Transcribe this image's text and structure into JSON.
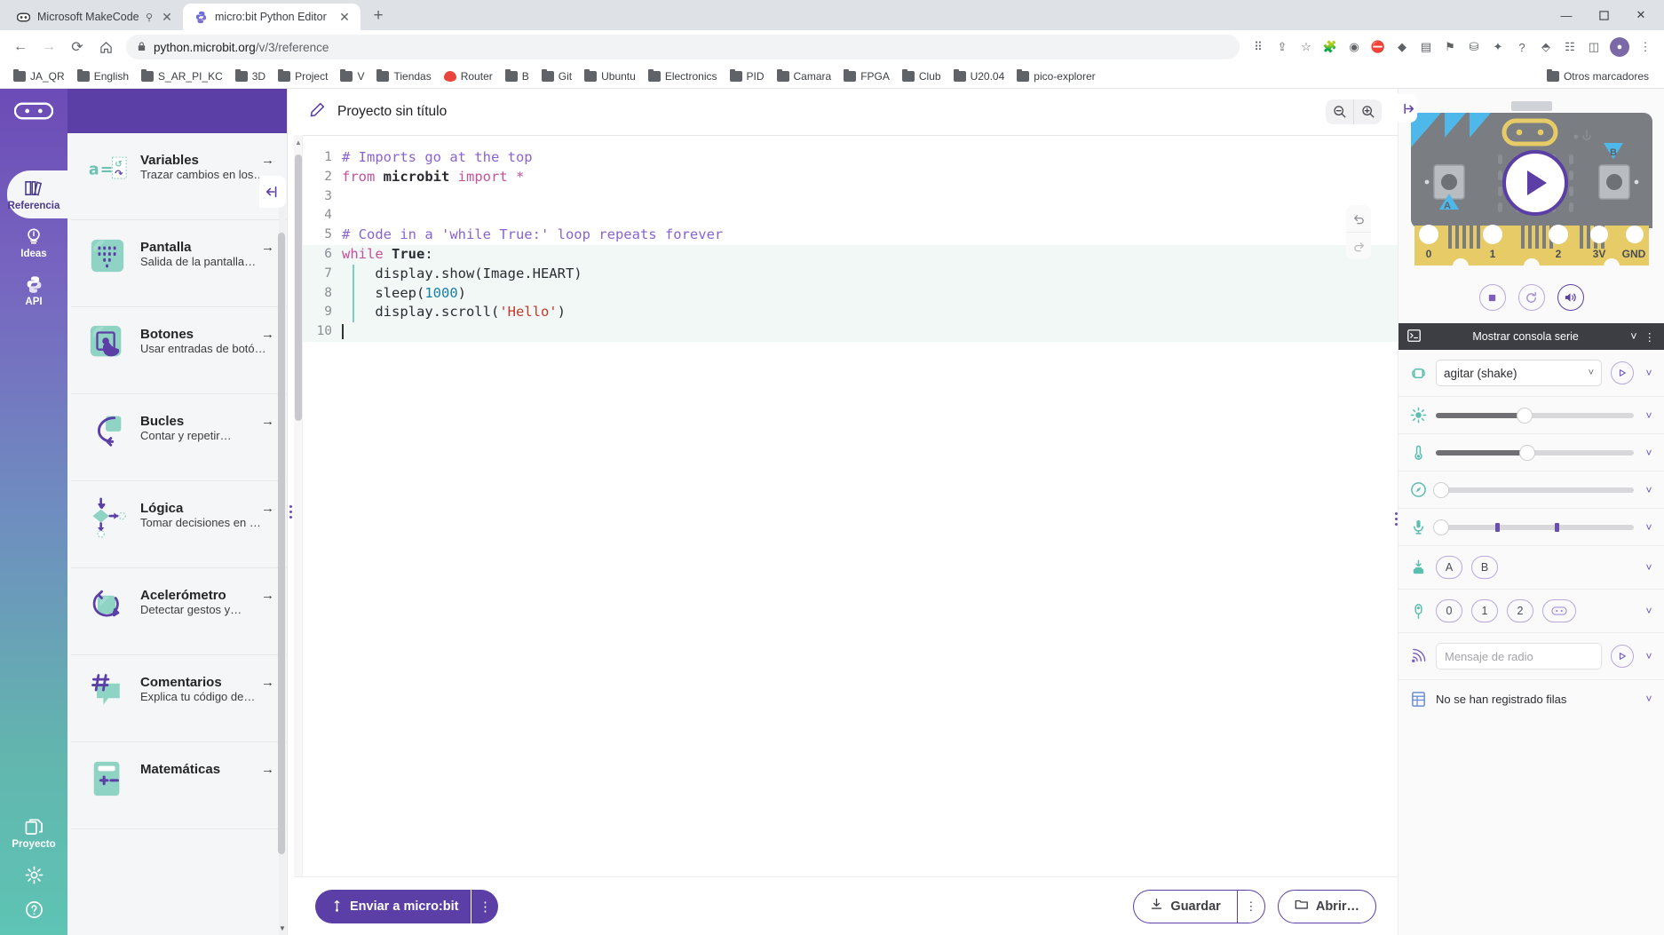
{
  "browser": {
    "tabs": [
      {
        "title": "Microsoft MakeCode for m",
        "favicon": "makecode-icon",
        "active": false
      },
      {
        "title": "micro:bit Python Editor",
        "favicon": "python-icon",
        "active": true
      }
    ],
    "new_tab_label": "+",
    "window_controls": {
      "minimize": "—",
      "maximize": "❑",
      "close": "✕"
    },
    "nav": {
      "back": "←",
      "forward": "→",
      "reload": "⟳",
      "home": "⌂"
    },
    "omnibox": {
      "lock": "🔒",
      "url_main": "python.microbit.org",
      "url_rest": "/v/3/reference"
    },
    "toolbar_icons": [
      "translate-icon",
      "share-icon",
      "star-icon",
      "extension-puzzle-icon",
      "grammarly-icon",
      "adblock-icon",
      "colorpick-icon",
      "wallet-icon",
      "bookmark-manager-icon",
      "screencast-icon",
      "lastpass-icon",
      "help-icon",
      "extensions-icon",
      "reading-list-icon",
      "sidepanel-icon"
    ],
    "profile_initial": "👤",
    "menu_icon": "⋮",
    "bookmarks": [
      {
        "label": "JA_QR",
        "icon": "folder-icon"
      },
      {
        "label": "English",
        "icon": "folder-icon"
      },
      {
        "label": "S_AR_PI_KC",
        "icon": "folder-icon"
      },
      {
        "label": "3D",
        "icon": "folder-icon"
      },
      {
        "label": "Project",
        "icon": "folder-icon"
      },
      {
        "label": "V",
        "icon": "folder-icon"
      },
      {
        "label": "Tiendas",
        "icon": "folder-icon"
      },
      {
        "label": "Router",
        "icon": "vodafone-icon"
      },
      {
        "label": "B",
        "icon": "folder-icon"
      },
      {
        "label": "Git",
        "icon": "folder-icon"
      },
      {
        "label": "Ubuntu",
        "icon": "folder-icon"
      },
      {
        "label": "Electronics",
        "icon": "folder-icon"
      },
      {
        "label": "PID",
        "icon": "folder-icon"
      },
      {
        "label": "Camara",
        "icon": "folder-icon"
      },
      {
        "label": "FPGA",
        "icon": "folder-icon"
      },
      {
        "label": "Club",
        "icon": "folder-icon"
      },
      {
        "label": "U20.04",
        "icon": "folder-icon"
      },
      {
        "label": "pico-explorer",
        "icon": "folder-icon"
      }
    ],
    "bookmarks_right": {
      "label": "Otros marcadores",
      "icon": "folder-icon"
    }
  },
  "rail": {
    "logo": "micro:bit",
    "search_icon": "search-icon",
    "items": [
      {
        "label": "Referencia",
        "icon": "book-icon",
        "active": true
      },
      {
        "label": "Ideas",
        "icon": "lightbulb-icon",
        "active": false
      },
      {
        "label": "API",
        "icon": "python-icon",
        "active": false
      }
    ],
    "bottom_items": [
      {
        "label": "Proyecto",
        "icon": "files-icon"
      },
      {
        "label": "",
        "icon": "gear-icon"
      },
      {
        "label": "",
        "icon": "help-circle-icon"
      }
    ]
  },
  "reference": {
    "collapse_icon": "collapse-left-icon",
    "items": [
      {
        "title": "Variables",
        "desc": "Trazar cambios en los…",
        "icon": "variables-icon",
        "arrow": "→"
      },
      {
        "title": "Pantalla",
        "desc": "Salida de la pantalla…",
        "icon": "display-icon",
        "arrow": "→"
      },
      {
        "title": "Botones",
        "desc": "Usar entradas de botó…",
        "icon": "buttons-icon",
        "arrow": "→"
      },
      {
        "title": "Bucles",
        "desc": "Contar y repetir…",
        "icon": "loops-icon",
        "arrow": "→"
      },
      {
        "title": "Lógica",
        "desc": "Tomar decisiones en …",
        "icon": "logic-icon",
        "arrow": "→"
      },
      {
        "title": "Acelerómetro",
        "desc": "Detectar gestos y…",
        "icon": "accelerometer-icon",
        "arrow": "→"
      },
      {
        "title": "Comentarios",
        "desc": "Explica tu código de…",
        "icon": "comments-icon",
        "arrow": "→"
      },
      {
        "title": "Matemáticas",
        "desc": "",
        "icon": "math-icon",
        "arrow": "→"
      }
    ]
  },
  "editor": {
    "pencil_icon": "pencil-icon",
    "project_title": "Proyecto sin título",
    "zoom_out_icon": "zoom-out-icon",
    "zoom_in_icon": "zoom-in-icon",
    "undo_icon": "undo-icon",
    "redo_icon": "redo-icon",
    "lines": [
      {
        "n": "1",
        "segs": [
          {
            "t": "# Imports go at the top",
            "c": "tok-c"
          }
        ]
      },
      {
        "n": "2",
        "segs": [
          {
            "t": "from ",
            "c": "tok-k"
          },
          {
            "t": "microbit",
            "c": "tok-b"
          },
          {
            "t": " ",
            "c": ""
          },
          {
            "t": "import",
            "c": "tok-k"
          },
          {
            "t": " ",
            "c": ""
          },
          {
            "t": "*",
            "c": "tok-k"
          }
        ]
      },
      {
        "n": "3",
        "segs": []
      },
      {
        "n": "4",
        "segs": []
      },
      {
        "n": "5",
        "segs": [
          {
            "t": "# Code in a 'while True:' loop repeats forever",
            "c": "tok-c"
          }
        ]
      },
      {
        "n": "6",
        "segs": [
          {
            "t": "while",
            "c": "tok-k"
          },
          {
            "t": " ",
            "c": ""
          },
          {
            "t": "True",
            "c": "tok-b"
          },
          {
            "t": ":",
            "c": ""
          }
        ],
        "hl": true
      },
      {
        "n": "7",
        "segs": [
          {
            "t": "    display.show(Image.HEART)",
            "c": ""
          }
        ],
        "hl": true,
        "guide": true
      },
      {
        "n": "8",
        "segs": [
          {
            "t": "    sleep(",
            "c": ""
          },
          {
            "t": "1000",
            "c": "tok-n"
          },
          {
            "t": ")",
            "c": ""
          }
        ],
        "hl": true,
        "guide": true
      },
      {
        "n": "9",
        "segs": [
          {
            "t": "    display.scroll(",
            "c": ""
          },
          {
            "t": "'Hello'",
            "c": "tok-s"
          },
          {
            "t": ")",
            "c": ""
          }
        ],
        "hl": true,
        "guide": true
      },
      {
        "n": "10",
        "segs": [],
        "hl": true,
        "caret": true
      }
    ],
    "footer": {
      "send_label": "Enviar a micro:bit",
      "send_icon": "usb-icon",
      "send_more_icon": "⋮",
      "save_label": "Guardar",
      "save_icon": "download-icon",
      "save_more_icon": "⋮",
      "open_label": "Abrir…",
      "open_icon": "folder-open-icon"
    }
  },
  "simulator": {
    "expand_icon": "expand-right-icon",
    "board": {
      "play_icon": "play-icon",
      "pins": [
        "0",
        "1",
        "2",
        "3V",
        "GND"
      ],
      "label_a": "A",
      "label_b": "B"
    },
    "controls": [
      {
        "icon": "stop-icon",
        "name": "stop-button"
      },
      {
        "icon": "reset-icon",
        "name": "reset-button"
      },
      {
        "icon": "sound-icon",
        "name": "mute-button"
      }
    ],
    "serial": {
      "terminal_icon": "terminal-icon",
      "title": "Mostrar consola serie",
      "chevron": "˅",
      "menu": "⋮"
    },
    "sensors": [
      {
        "type": "select",
        "icon": "gesture-icon",
        "name": "gesture",
        "value": "agitar (shake)",
        "chevron": "˅",
        "play_icon": "play-icon",
        "row_chevron": "˅"
      },
      {
        "type": "slider",
        "icon": "light-icon",
        "name": "light-level",
        "fill": 45,
        "knob": 45,
        "row_chevron": "˅"
      },
      {
        "type": "slider",
        "icon": "temperature-icon",
        "name": "temperature",
        "fill": 46,
        "knob": 46,
        "row_chevron": "˅"
      },
      {
        "type": "slider",
        "icon": "compass-icon",
        "name": "compass-heading",
        "fill": 0,
        "knob": 0,
        "row_chevron": "˅"
      },
      {
        "type": "slider",
        "icon": "microphone-icon",
        "name": "sound-level",
        "fill": 0,
        "knob": 0,
        "marks": [
          30,
          60
        ],
        "row_chevron": "˅"
      },
      {
        "type": "pills",
        "icon": "buttons-press-icon",
        "name": "buttons",
        "pills": [
          "A",
          "B"
        ],
        "row_chevron": "˅"
      },
      {
        "type": "pills",
        "icon": "pins-icon",
        "name": "pins",
        "pills": [
          "0",
          "1",
          "2",
          "logo"
        ],
        "row_chevron": "˅"
      },
      {
        "type": "radio",
        "icon": "radio-icon",
        "name": "radio",
        "placeholder": "Mensaje de radio",
        "play_icon": "play-icon",
        "row_chevron": "˅"
      },
      {
        "type": "text",
        "icon": "datalog-icon",
        "name": "data-log",
        "text": "No se han registrado filas",
        "row_chevron": "˅"
      }
    ]
  },
  "colors": {
    "brand_purple": "#5b3fa6",
    "teal": "#5bbfae",
    "comment_purple": "#8a63d2",
    "keyword_pink": "#c4519c",
    "string_red": "#c0392b",
    "number_blue": "#1a7fa8"
  }
}
